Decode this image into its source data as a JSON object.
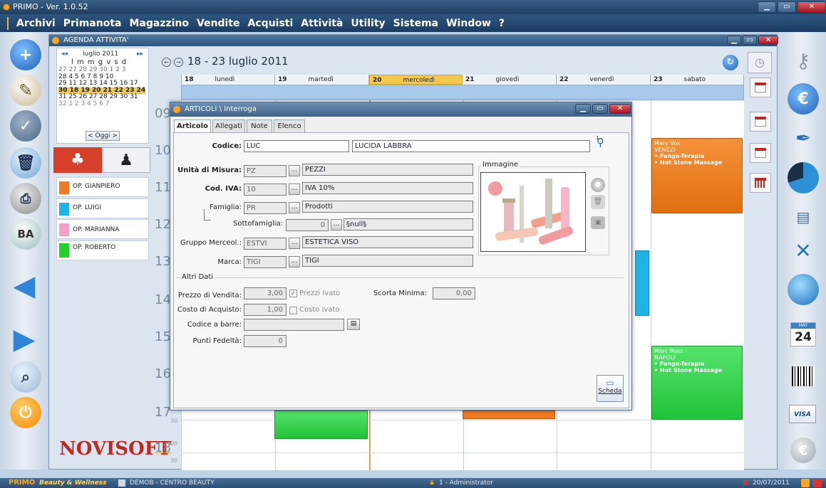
{
  "app": {
    "title": "PRIMO - Ver. 1.0.52"
  },
  "menu": [
    "Archivi",
    "Primanota",
    "Magazzino",
    "Vendite",
    "Acquisti",
    "Attività",
    "Utility",
    "Sistema",
    "Window",
    "?"
  ],
  "agenda": {
    "title": "AGENDA ATTIVITA'",
    "mini_month": "luglio 2011",
    "mini_days_header": "l m m g v s d",
    "mini_rows": [
      {
        "wk": "27",
        "days": "27 28 29 30  1  2  3"
      },
      {
        "wk": "28",
        "days": "4  5  6  7  8  9 10"
      },
      {
        "wk": "29",
        "days": "11 12 13 14 15 16 17"
      },
      {
        "wk": "30",
        "days": "18 19 20 21 22 23 24"
      },
      {
        "wk": "31",
        "days": "25 26 27 28 29 30 31"
      },
      {
        "wk": "32",
        "days": "1  2  3  4  5  6  7"
      }
    ],
    "today_button": "< Oggi >",
    "week_range": "18 - 23 luglio 2011",
    "days": [
      {
        "num": "18",
        "name": "lunedì"
      },
      {
        "num": "19",
        "name": "martedì"
      },
      {
        "num": "20",
        "name": "mercoledì"
      },
      {
        "num": "21",
        "name": "giovedì"
      },
      {
        "num": "22",
        "name": "venerdì"
      },
      {
        "num": "23",
        "name": "sabato"
      }
    ],
    "hours": [
      "09",
      "10",
      "11",
      "12",
      "13",
      "14",
      "15",
      "16",
      "17",
      "18"
    ],
    "half_label": "30",
    "hour_sup": "00",
    "operators": [
      {
        "name": "OP. GIANPIERO",
        "color": "#f07a1e"
      },
      {
        "name": "OP. LUIGI",
        "color": "#1eb4e6"
      },
      {
        "name": "OP. MARIANNA",
        "color": "#f4a0c8"
      },
      {
        "name": "OP. ROBERTO",
        "color": "#22d22a"
      }
    ],
    "events": [
      {
        "name": "Mary Vox",
        "city": "VENEZI",
        "items": [
          "• Fango-Terapia",
          "• Hot Stone Massage"
        ],
        "color": "#f07a1e"
      },
      {
        "name": "Marc Ross",
        "city": "NAPOLI",
        "items": [
          "• Fango-Terapia",
          "• Hot Stone Massage"
        ],
        "color": "#2fd24a"
      }
    ]
  },
  "dialog": {
    "title": "ARTICOLI \\ Interroga",
    "tabs": [
      "Articolo",
      "Allegati",
      "Note",
      "Elenco"
    ],
    "codice_label": "Codice:",
    "codice": "LUC",
    "descrizione": "LUCIDA LABBRA",
    "attach_count": "1",
    "um_label": "Unità di Misura:",
    "um_code": "PZ",
    "um_desc": "PEZZI",
    "iva_label": "Cod. IVA:",
    "iva_code": "10",
    "iva_desc": "IVA 10%",
    "fam_label": "Famiglia:",
    "fam_code": "PR",
    "fam_desc": "Prodotti",
    "sottofam_label": "Sottofamiglia:",
    "sottofam_code": "0",
    "sottofam_desc": "§null§",
    "gruppo_label": "Gruppo Merceol.:",
    "gruppo_code": "ESTVI",
    "gruppo_desc": "ESTETICA VISO",
    "marca_label": "Marca:",
    "marca_code": "TIGI",
    "marca_desc": "TIGI",
    "image_label": "Immagine",
    "altri_dati": "Altri Dati",
    "prezzo_label": "Prezzo di Vendita:",
    "prezzo": "3,00",
    "prezzi_ivato": "Prezzi Ivato",
    "scorta_label": "Scorta Minima:",
    "scorta": "0,00",
    "costo_label": "Costo di Acquisto:",
    "costo": "1,00",
    "costo_ivato": "Costo Ivato",
    "barre_label": "Codice a barre:",
    "barre": "",
    "punti_label": "Punti Fedeltà:",
    "punti": "0",
    "scheda_button": "Scheda"
  },
  "logo": {
    "text": "NOVISOFT"
  },
  "right_rail": {
    "calendar_month": "MAY",
    "calendar_day": "24",
    "card_label": "VISA"
  },
  "status": {
    "brand": "PRIMO",
    "product": "Beauty & Wellness",
    "company": "DEMOB - CENTRO BEAUTY",
    "user": "1 - Administrator",
    "date": "20/07/2011"
  }
}
